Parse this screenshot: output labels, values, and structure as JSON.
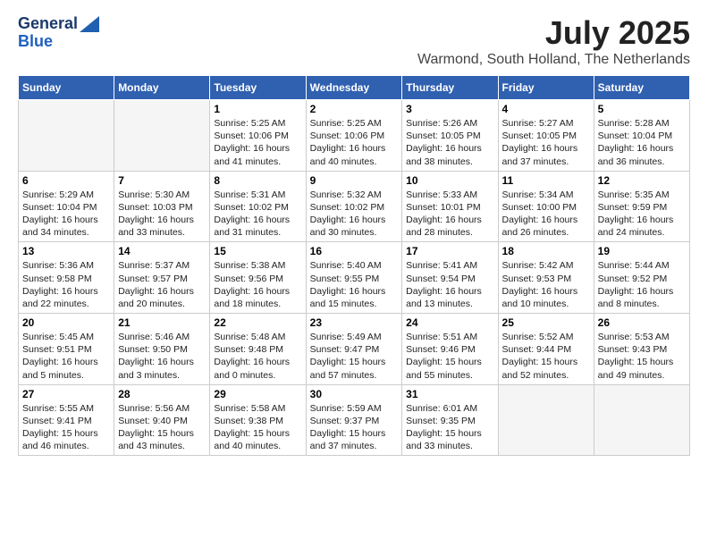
{
  "header": {
    "logo_line1": "General",
    "logo_line2": "Blue",
    "month": "July 2025",
    "location": "Warmond, South Holland, The Netherlands"
  },
  "weekdays": [
    "Sunday",
    "Monday",
    "Tuesday",
    "Wednesday",
    "Thursday",
    "Friday",
    "Saturday"
  ],
  "weeks": [
    [
      {
        "day": "",
        "text": ""
      },
      {
        "day": "",
        "text": ""
      },
      {
        "day": "1",
        "text": "Sunrise: 5:25 AM\nSunset: 10:06 PM\nDaylight: 16 hours\nand 41 minutes."
      },
      {
        "day": "2",
        "text": "Sunrise: 5:25 AM\nSunset: 10:06 PM\nDaylight: 16 hours\nand 40 minutes."
      },
      {
        "day": "3",
        "text": "Sunrise: 5:26 AM\nSunset: 10:05 PM\nDaylight: 16 hours\nand 38 minutes."
      },
      {
        "day": "4",
        "text": "Sunrise: 5:27 AM\nSunset: 10:05 PM\nDaylight: 16 hours\nand 37 minutes."
      },
      {
        "day": "5",
        "text": "Sunrise: 5:28 AM\nSunset: 10:04 PM\nDaylight: 16 hours\nand 36 minutes."
      }
    ],
    [
      {
        "day": "6",
        "text": "Sunrise: 5:29 AM\nSunset: 10:04 PM\nDaylight: 16 hours\nand 34 minutes."
      },
      {
        "day": "7",
        "text": "Sunrise: 5:30 AM\nSunset: 10:03 PM\nDaylight: 16 hours\nand 33 minutes."
      },
      {
        "day": "8",
        "text": "Sunrise: 5:31 AM\nSunset: 10:02 PM\nDaylight: 16 hours\nand 31 minutes."
      },
      {
        "day": "9",
        "text": "Sunrise: 5:32 AM\nSunset: 10:02 PM\nDaylight: 16 hours\nand 30 minutes."
      },
      {
        "day": "10",
        "text": "Sunrise: 5:33 AM\nSunset: 10:01 PM\nDaylight: 16 hours\nand 28 minutes."
      },
      {
        "day": "11",
        "text": "Sunrise: 5:34 AM\nSunset: 10:00 PM\nDaylight: 16 hours\nand 26 minutes."
      },
      {
        "day": "12",
        "text": "Sunrise: 5:35 AM\nSunset: 9:59 PM\nDaylight: 16 hours\nand 24 minutes."
      }
    ],
    [
      {
        "day": "13",
        "text": "Sunrise: 5:36 AM\nSunset: 9:58 PM\nDaylight: 16 hours\nand 22 minutes."
      },
      {
        "day": "14",
        "text": "Sunrise: 5:37 AM\nSunset: 9:57 PM\nDaylight: 16 hours\nand 20 minutes."
      },
      {
        "day": "15",
        "text": "Sunrise: 5:38 AM\nSunset: 9:56 PM\nDaylight: 16 hours\nand 18 minutes."
      },
      {
        "day": "16",
        "text": "Sunrise: 5:40 AM\nSunset: 9:55 PM\nDaylight: 16 hours\nand 15 minutes."
      },
      {
        "day": "17",
        "text": "Sunrise: 5:41 AM\nSunset: 9:54 PM\nDaylight: 16 hours\nand 13 minutes."
      },
      {
        "day": "18",
        "text": "Sunrise: 5:42 AM\nSunset: 9:53 PM\nDaylight: 16 hours\nand 10 minutes."
      },
      {
        "day": "19",
        "text": "Sunrise: 5:44 AM\nSunset: 9:52 PM\nDaylight: 16 hours\nand 8 minutes."
      }
    ],
    [
      {
        "day": "20",
        "text": "Sunrise: 5:45 AM\nSunset: 9:51 PM\nDaylight: 16 hours\nand 5 minutes."
      },
      {
        "day": "21",
        "text": "Sunrise: 5:46 AM\nSunset: 9:50 PM\nDaylight: 16 hours\nand 3 minutes."
      },
      {
        "day": "22",
        "text": "Sunrise: 5:48 AM\nSunset: 9:48 PM\nDaylight: 16 hours\nand 0 minutes."
      },
      {
        "day": "23",
        "text": "Sunrise: 5:49 AM\nSunset: 9:47 PM\nDaylight: 15 hours\nand 57 minutes."
      },
      {
        "day": "24",
        "text": "Sunrise: 5:51 AM\nSunset: 9:46 PM\nDaylight: 15 hours\nand 55 minutes."
      },
      {
        "day": "25",
        "text": "Sunrise: 5:52 AM\nSunset: 9:44 PM\nDaylight: 15 hours\nand 52 minutes."
      },
      {
        "day": "26",
        "text": "Sunrise: 5:53 AM\nSunset: 9:43 PM\nDaylight: 15 hours\nand 49 minutes."
      }
    ],
    [
      {
        "day": "27",
        "text": "Sunrise: 5:55 AM\nSunset: 9:41 PM\nDaylight: 15 hours\nand 46 minutes."
      },
      {
        "day": "28",
        "text": "Sunrise: 5:56 AM\nSunset: 9:40 PM\nDaylight: 15 hours\nand 43 minutes."
      },
      {
        "day": "29",
        "text": "Sunrise: 5:58 AM\nSunset: 9:38 PM\nDaylight: 15 hours\nand 40 minutes."
      },
      {
        "day": "30",
        "text": "Sunrise: 5:59 AM\nSunset: 9:37 PM\nDaylight: 15 hours\nand 37 minutes."
      },
      {
        "day": "31",
        "text": "Sunrise: 6:01 AM\nSunset: 9:35 PM\nDaylight: 15 hours\nand 33 minutes."
      },
      {
        "day": "",
        "text": ""
      },
      {
        "day": "",
        "text": ""
      }
    ]
  ]
}
